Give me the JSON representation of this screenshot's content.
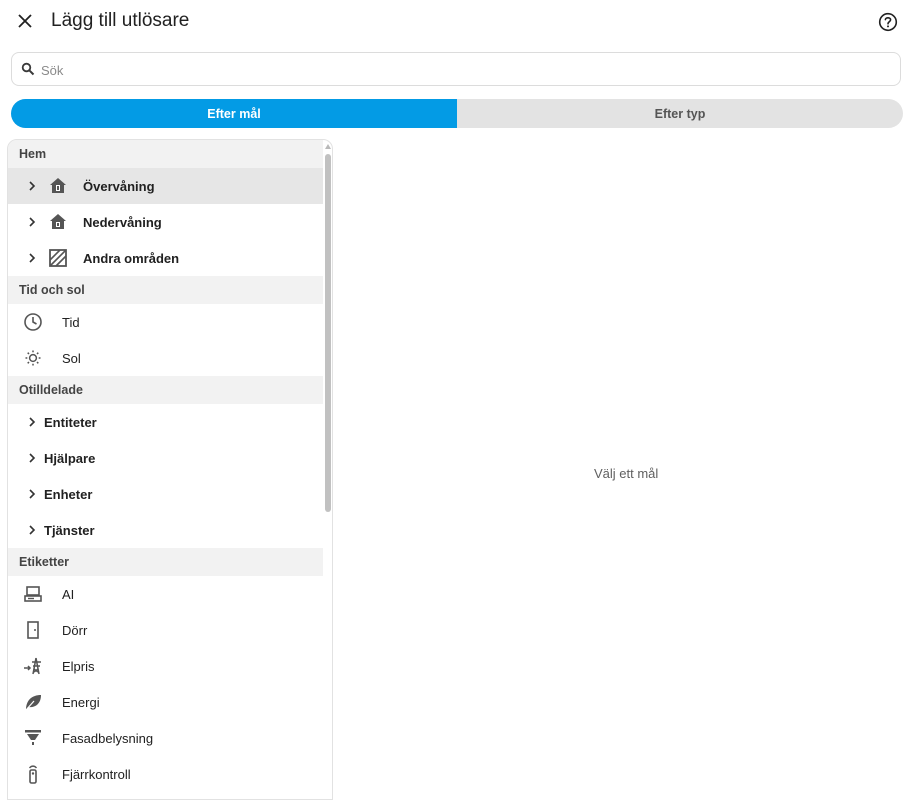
{
  "dialog": {
    "title": "Lägg till utlösare"
  },
  "search": {
    "placeholder": "Sök"
  },
  "tabs": [
    {
      "label": "Efter mål",
      "active": true
    },
    {
      "label": "Efter typ",
      "active": false
    }
  ],
  "sections": {
    "hem": {
      "title": "Hem",
      "items": [
        {
          "label": "Övervåning",
          "icon": "home-floor-upper-icon",
          "selected": true
        },
        {
          "label": "Nedervåning",
          "icon": "home-floor-lower-icon"
        },
        {
          "label": "Andra områden",
          "icon": "hatched-square-icon"
        }
      ]
    },
    "tid": {
      "title": "Tid och sol",
      "items": [
        {
          "label": "Tid",
          "icon": "clock-icon"
        },
        {
          "label": "Sol",
          "icon": "sun-icon"
        }
      ]
    },
    "otilldelade": {
      "title": "Otilldelade",
      "items": [
        {
          "label": "Entiteter"
        },
        {
          "label": "Hjälpare"
        },
        {
          "label": "Enheter"
        },
        {
          "label": "Tjänster"
        }
      ]
    },
    "etiketter": {
      "title": "Etiketter",
      "items": [
        {
          "label": "AI",
          "icon": "laptop-icon"
        },
        {
          "label": "Dörr",
          "icon": "door-icon"
        },
        {
          "label": "Elpris",
          "icon": "transmission-tower-icon"
        },
        {
          "label": "Energi",
          "icon": "leaf-icon"
        },
        {
          "label": "Fasadbelysning",
          "icon": "ceiling-light-icon"
        },
        {
          "label": "Fjärrkontroll",
          "icon": "remote-icon"
        }
      ]
    }
  },
  "detail": {
    "empty_text": "Välj ett mål"
  },
  "colors": {
    "accent": "#039be5",
    "section_bg": "#f2f2f2",
    "selected_bg": "#e6e6e6"
  }
}
